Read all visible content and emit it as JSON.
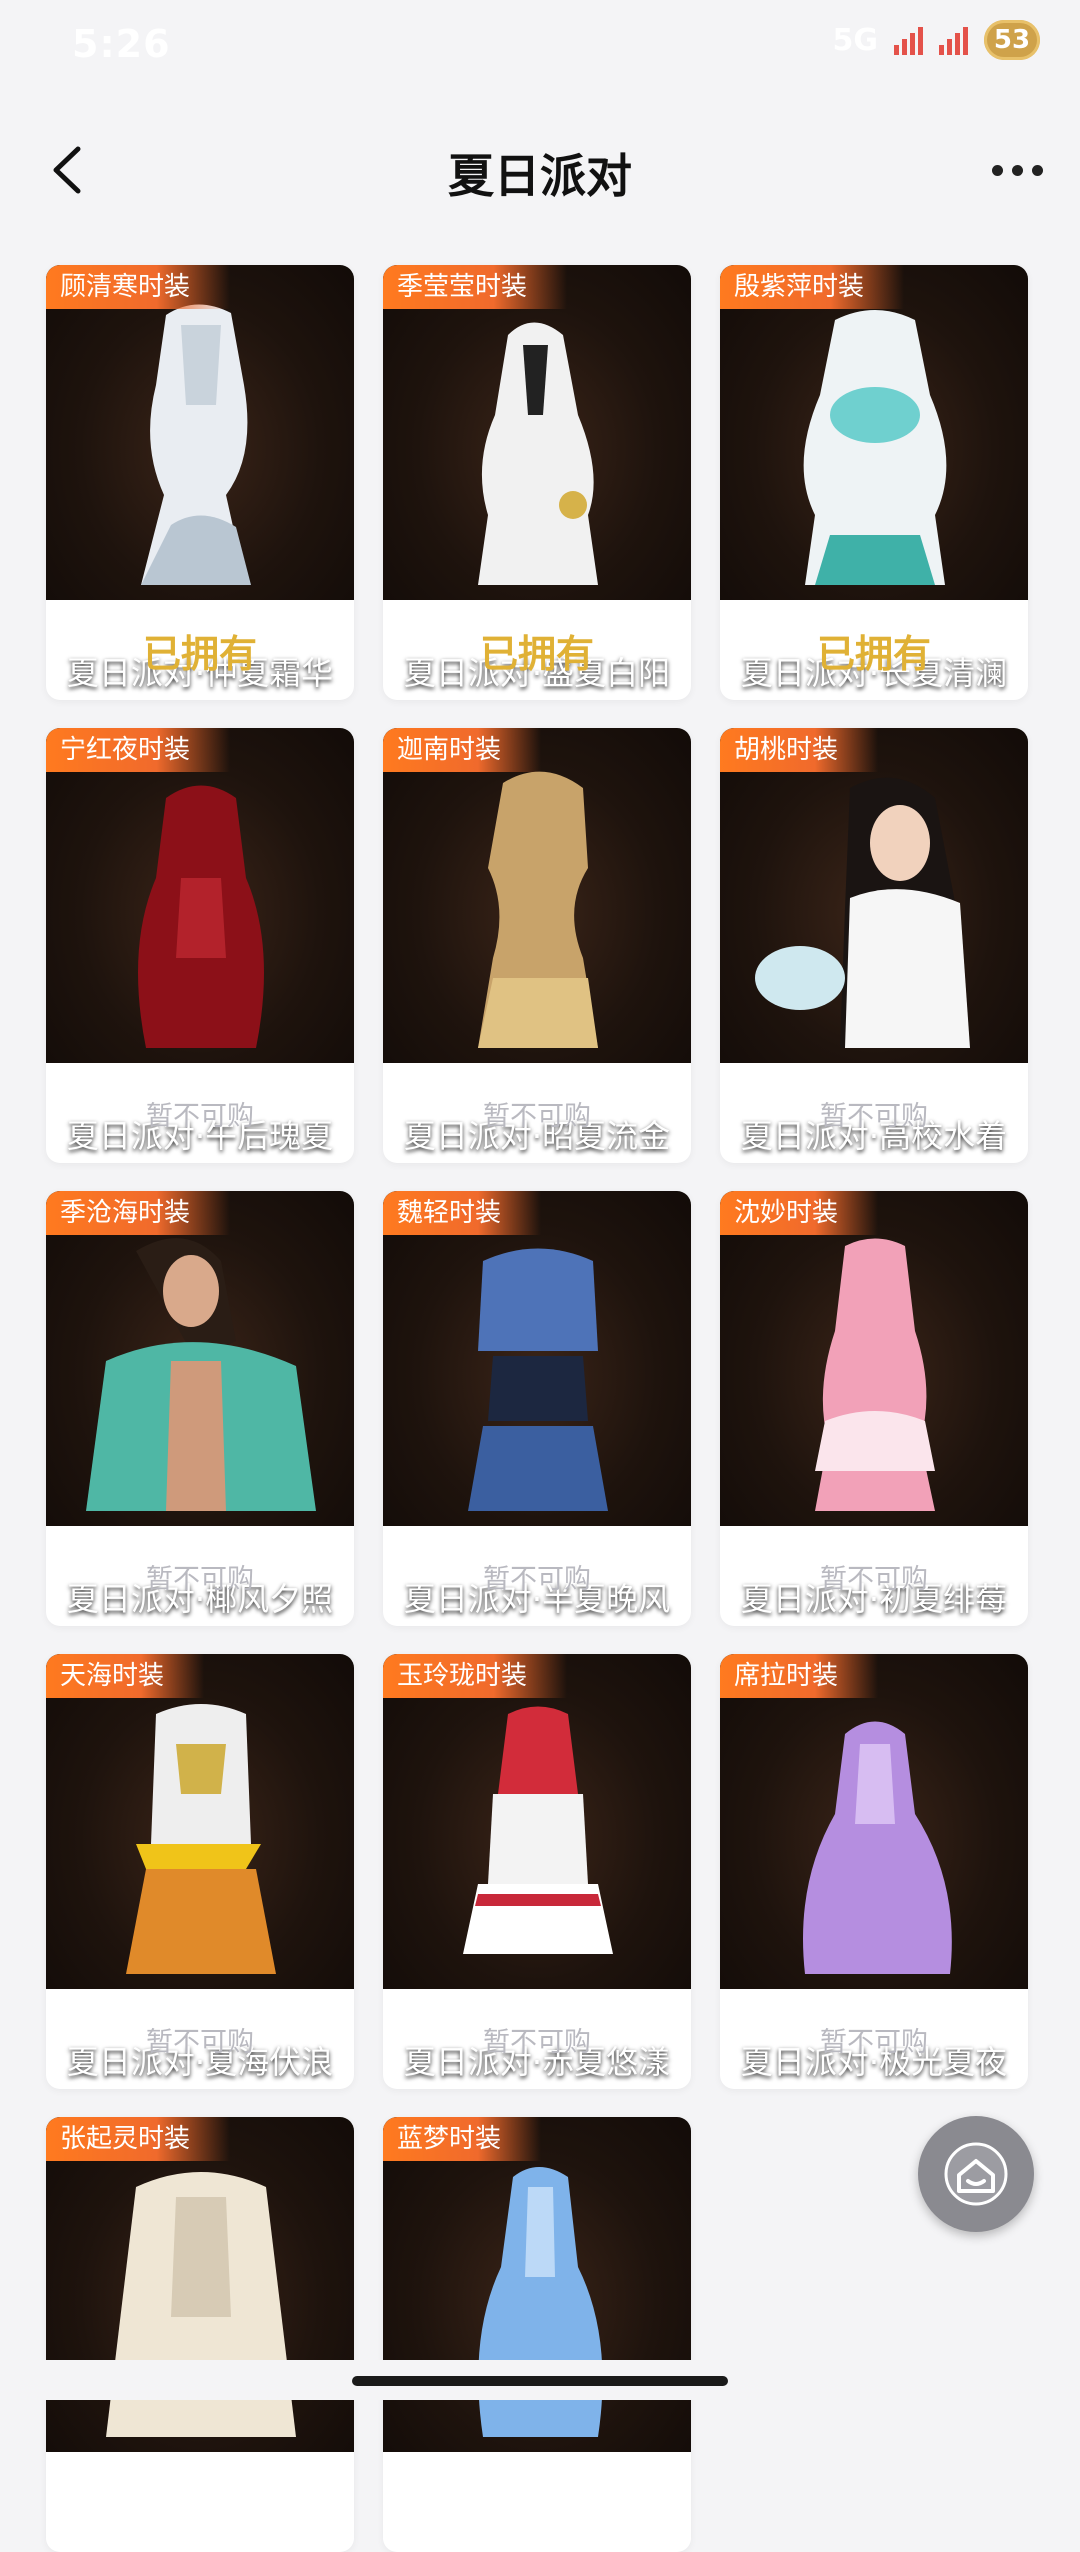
{
  "status_bar": {
    "time": "5:26",
    "network": "5G",
    "battery": "53"
  },
  "header": {
    "title": "夏日派对"
  },
  "items": [
    {
      "tag": "顾清寒时装",
      "name": "夏日派对·仲夏霜华",
      "status": "已拥有",
      "owned": true
    },
    {
      "tag": "季莹莹时装",
      "name": "夏日派对·盛夏白阳",
      "status": "已拥有",
      "owned": true
    },
    {
      "tag": "殷紫萍时装",
      "name": "夏日派对·长夏清澜",
      "status": "已拥有",
      "owned": true
    },
    {
      "tag": "宁红夜时装",
      "name": "夏日派对·午后瑰夏",
      "status": "暂不可购",
      "owned": false
    },
    {
      "tag": "迦南时装",
      "name": "夏日派对·昭夏流金",
      "status": "暂不可购",
      "owned": false
    },
    {
      "tag": "胡桃时装",
      "name": "夏日派对·高校水着",
      "status": "暂不可购",
      "owned": false
    },
    {
      "tag": "季沧海时装",
      "name": "夏日派对·椰风夕照",
      "status": "暂不可购",
      "owned": false
    },
    {
      "tag": "魏轻时装",
      "name": "夏日派对·半夏晚风",
      "status": "暂不可购",
      "owned": false
    },
    {
      "tag": "沈妙时装",
      "name": "夏日派对·初夏绯莓",
      "status": "暂不可购",
      "owned": false
    },
    {
      "tag": "天海时装",
      "name": "夏日派对·夏海伏浪",
      "status": "暂不可购",
      "owned": false
    },
    {
      "tag": "玉玲珑时装",
      "name": "夏日派对·赤夏悠漾",
      "status": "暂不可购",
      "owned": false
    },
    {
      "tag": "席拉时装",
      "name": "夏日派对·极光夏夜",
      "status": "暂不可购",
      "owned": false
    },
    {
      "tag": "张起灵时装",
      "name": "",
      "status": "",
      "owned": false
    },
    {
      "tag": "蓝梦时装",
      "name": "",
      "status": "",
      "owned": false
    }
  ],
  "colors": {
    "tag_gradient": "#ff7a1f",
    "owned_text": "#e0b135",
    "unavailable_text": "#b9b9c0",
    "card_bg": "#ffffff",
    "page_bg": "#f4f4f6"
  },
  "icons": {
    "back": "chevron-left-icon",
    "more": "more-dots-icon",
    "home": "home-icon"
  }
}
